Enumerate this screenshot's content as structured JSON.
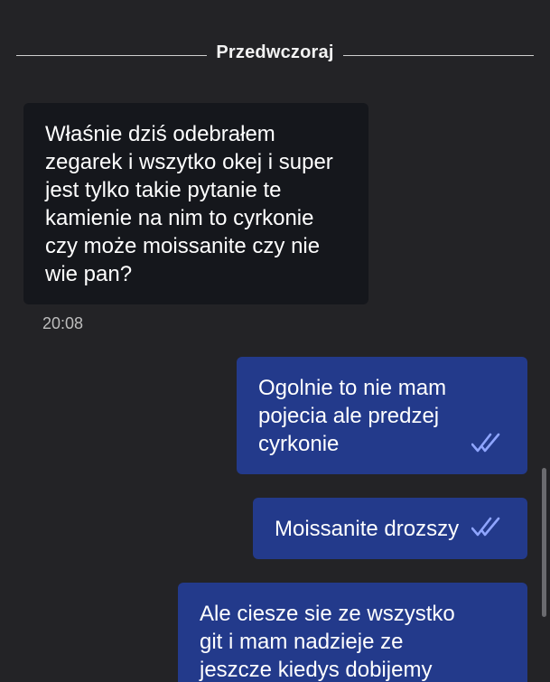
{
  "chat": {
    "date_divider": "Przedwczoraj",
    "messages": [
      {
        "direction": "incoming",
        "lines": [
          "Właśnie dziś odebrałem",
          "zegarek i wszytko okej i super",
          "jest tylko takie pytanie te",
          "kamienie na nim to cyrkonie",
          "czy może moissanite czy nie",
          "wie pan?"
        ],
        "time": "20:08"
      },
      {
        "direction": "outgoing",
        "lines": [
          "Ogolnie to nie mam",
          "pojecia ale predzej",
          "cyrkonie"
        ],
        "status_icon": "double-check-icon"
      },
      {
        "direction": "outgoing",
        "lines": [
          "Moissanite drozszy"
        ],
        "status_icon": "double-check-icon"
      },
      {
        "direction": "outgoing",
        "lines": [
          "Ale ciesze sie ze wszystko",
          "git i mam nadzieje ze",
          "jeszcze kiedys dobijemy"
        ]
      }
    ]
  },
  "colors": {
    "background": "#232326",
    "incoming_bubble": "#15171c",
    "outgoing_bubble": "#233a8b",
    "check_color": "#8fa5ff"
  }
}
